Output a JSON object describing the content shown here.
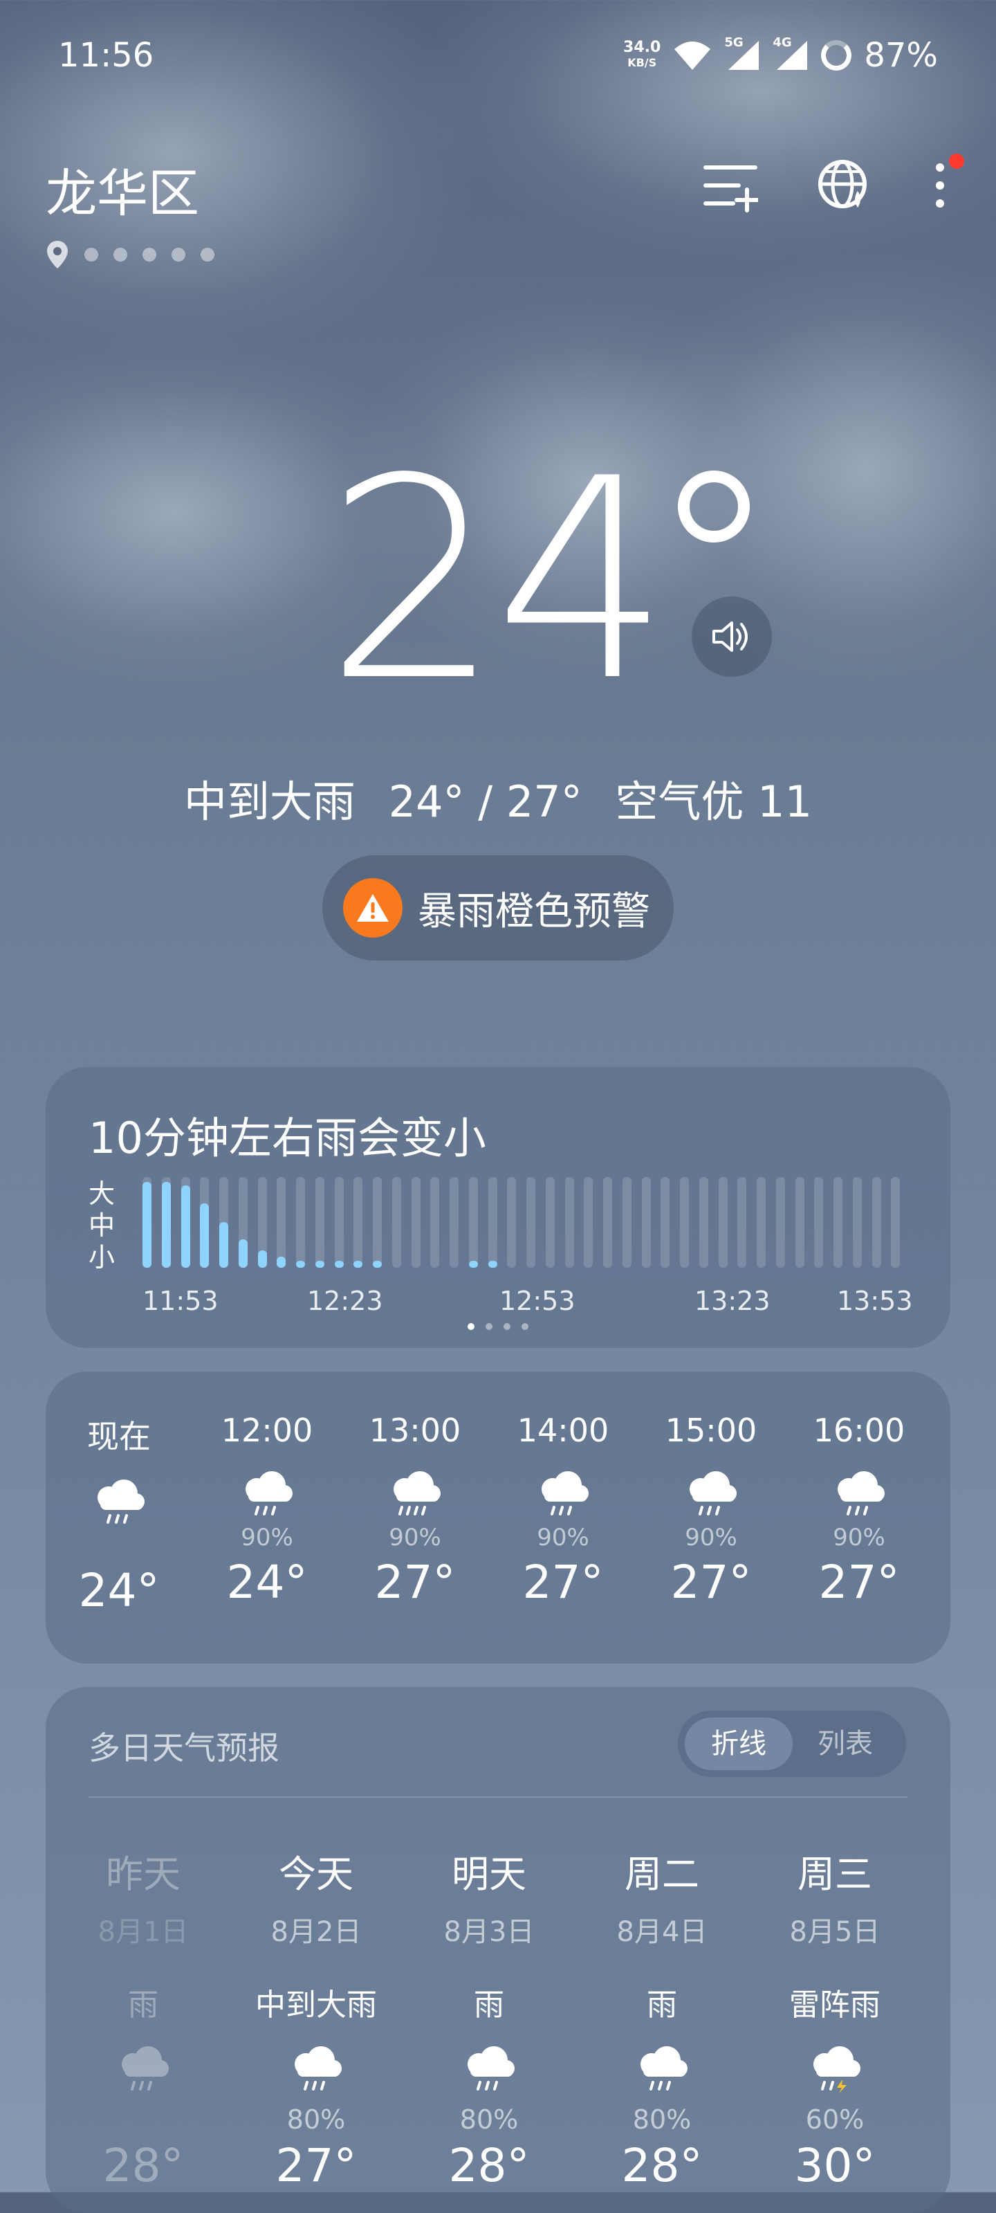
{
  "status_bar": {
    "time": "11:56",
    "net_speed_value": "34.0",
    "net_speed_unit": "KB/S",
    "signal_5g": "5G",
    "signal_4g": "4G",
    "battery": "87%"
  },
  "header": {
    "city": "龙华区",
    "page_count": 6
  },
  "current": {
    "temperature": "24",
    "condition": "中到大雨",
    "range": "24° / 27°",
    "air_quality": "空气优 11",
    "alert": "暴雨橙色预警"
  },
  "precip_card": {
    "title": "10分钟左右雨会变小",
    "y_labels": [
      "大",
      "中",
      "小"
    ],
    "time_labels": [
      "11:53",
      "12:23",
      "12:53",
      "13:23",
      "13:53"
    ],
    "intensity": [
      0.6,
      0.6,
      0.58,
      0.45,
      0.32,
      0.2,
      0.12,
      0.08,
      0.05,
      0.05,
      0.05,
      0.05,
      0.05,
      0,
      0,
      0,
      0,
      0.05,
      0.05,
      0,
      0,
      0,
      0,
      0,
      0,
      0,
      0,
      0,
      0,
      0,
      0,
      0,
      0,
      0,
      0,
      0,
      0,
      0,
      0,
      0
    ]
  },
  "hourly": [
    {
      "time": "现在",
      "pop": "",
      "temp": "24°"
    },
    {
      "time": "12:00",
      "pop": "90%",
      "temp": "24°"
    },
    {
      "time": "13:00",
      "pop": "90%",
      "temp": "27°"
    },
    {
      "time": "14:00",
      "pop": "90%",
      "temp": "27°"
    },
    {
      "time": "15:00",
      "pop": "90%",
      "temp": "27°"
    },
    {
      "time": "16:00",
      "pop": "90%",
      "temp": "27°"
    }
  ],
  "daily_card": {
    "title": "多日天气预报",
    "toggle_line": "折线",
    "toggle_list": "列表",
    "days": [
      {
        "name": "昨天",
        "date": "8月1日",
        "weather": "雨",
        "pop": "",
        "temp": "28°",
        "icon": "rain-icon"
      },
      {
        "name": "今天",
        "date": "8月2日",
        "weather": "中到大雨",
        "pop": "80%",
        "temp": "27°",
        "icon": "rain-icon"
      },
      {
        "name": "明天",
        "date": "8月3日",
        "weather": "雨",
        "pop": "80%",
        "temp": "28°",
        "icon": "rain-icon"
      },
      {
        "name": "周二",
        "date": "8月4日",
        "weather": "雨",
        "pop": "80%",
        "temp": "28°",
        "icon": "rain-icon"
      },
      {
        "name": "周三",
        "date": "8月5日",
        "weather": "雷阵雨",
        "pop": "60%",
        "temp": "30°",
        "icon": "thunderstorm-icon"
      }
    ]
  },
  "colors": {
    "precip_bar": "#8fd3ff",
    "precip_bar_empty": "rgba(255,255,255,0.16)",
    "alert_orange": "#f97a1e",
    "notification_dot": "#ff3b30"
  }
}
